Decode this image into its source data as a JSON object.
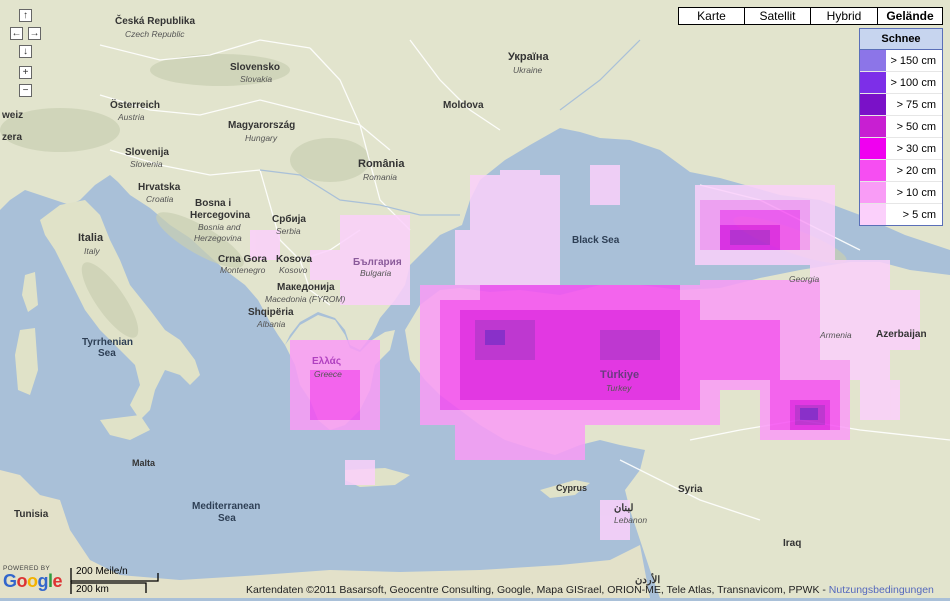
{
  "map_types": [
    {
      "label": "Karte",
      "active": false
    },
    {
      "label": "Satellit",
      "active": false
    },
    {
      "label": "Hybrid",
      "active": false
    },
    {
      "label": "Gelände",
      "active": true
    }
  ],
  "nav": {
    "up": "↑",
    "left": "←",
    "right": "→",
    "down": "↓",
    "zoom_in": "+",
    "zoom_out": "−"
  },
  "legend": {
    "title": "Schnee",
    "items": [
      {
        "label": "> 150 cm",
        "color": "#8c75e8"
      },
      {
        "label": "> 100 cm",
        "color": "#7d2fe8"
      },
      {
        "label": "> 75 cm",
        "color": "#7a11c8"
      },
      {
        "label": "> 50 cm",
        "color": "#c81fd2"
      },
      {
        "label": "> 30 cm",
        "color": "#f000f0"
      },
      {
        "label": "> 20 cm",
        "color": "#f64ef2"
      },
      {
        "label": "> 10 cm",
        "color": "#f99cf6"
      },
      {
        "label": "> 5 cm",
        "color": "#fbd0fb"
      }
    ]
  },
  "labels": {
    "ceska": "Česká Republika",
    "czech": "Czech Republic",
    "slovensko": "Slovensko",
    "slovakia": "Slovakia",
    "osterreich": "Österreich",
    "austria": "Austria",
    "schweiz": "weiz",
    "zerland": "zera",
    "magyar": "Magyarország",
    "hungary": "Hungary",
    "slovenija": "Slovenija",
    "slovenia": "Slovenia",
    "hrvatska": "Hrvatska",
    "croatia": "Croatia",
    "bosna1": "Bosna i",
    "bosna2": "Hercegovina",
    "bosnia1": "Bosnia and",
    "bosnia2": "Herzegovina",
    "srbija": "Србија",
    "serbia": "Serbia",
    "crnagora": "Crna Gora",
    "montenegro": "Montenegro",
    "kosova": "Kosova",
    "kosovo": "Kosovo",
    "makedonija": "Македонија",
    "macedonia": "Macedonia (FYROM)",
    "shqiperia": "Shqipëria",
    "albania": "Albania",
    "ukraina": "Україна",
    "ukraine": "Ukraine",
    "moldova": "Moldova",
    "romania": "România",
    "romania_en": "Romania",
    "bulgaria": "България",
    "bulgaria_en": "Bulgaria",
    "italia": "Italia",
    "italy": "Italy",
    "ellas": "Ελλάς",
    "greece": "Greece",
    "turkiye": "Türkiye",
    "turkey": "Turkey",
    "georgia": "Georgia",
    "armenia": "Armenia",
    "azerbaijan": "Azerbaijan",
    "syria": "Syria",
    "iraq": "Iraq",
    "lebanon_ar": "لبنان",
    "lebanon": "Lebanon",
    "jordan_ar": "الأردن",
    "cyprus": "Cyprus",
    "malta": "Malta",
    "tunisia": "Tunisia",
    "black_sea": "Black Sea",
    "tyrrhenian1": "Tyrrhenian",
    "tyrrhenian2": "Sea",
    "med1": "Mediterranean",
    "med2": "Sea"
  },
  "bottom": {
    "powered_by": "POWERED BY",
    "logo": "Google",
    "scale_top": "200 Meile/n",
    "scale_bottom": "200 km",
    "copyright": "Kartendaten ©2011 Basarsoft, Geocentre Consulting, Google, Mapa GISrael, ORION-ME, Tele Atlas, Transnavicom, PPWK - ",
    "terms": "Nutzungsbedingungen"
  }
}
